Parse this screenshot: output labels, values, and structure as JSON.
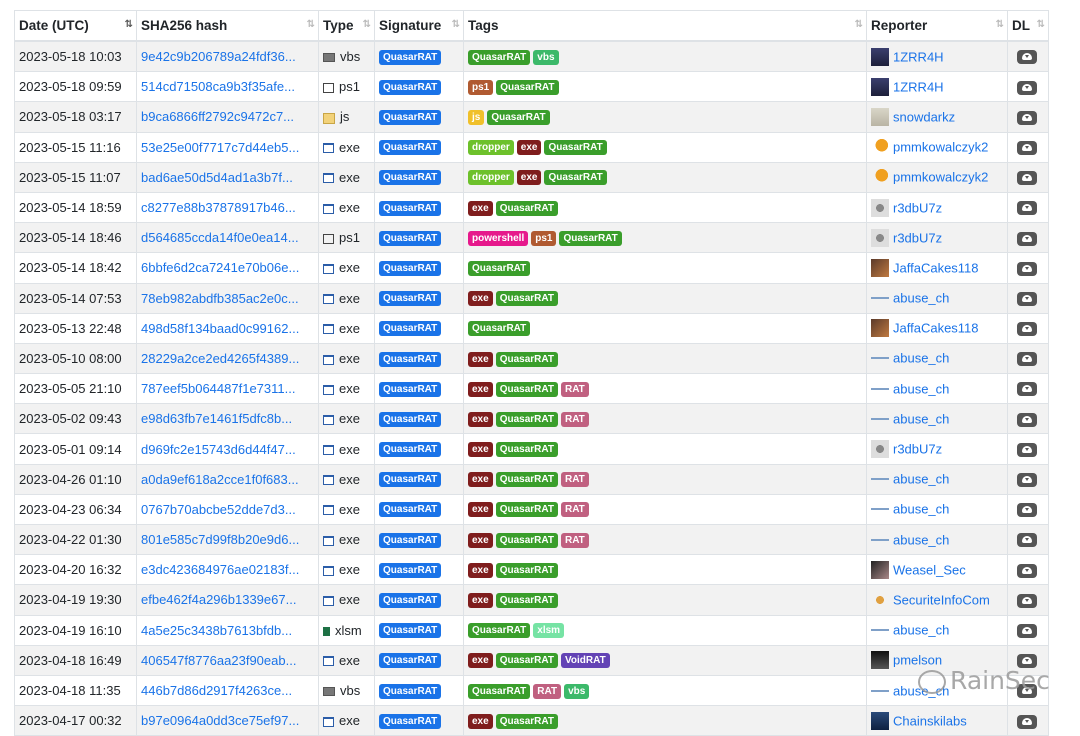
{
  "columns": {
    "date": "Date (UTC)",
    "hash": "SHA256 hash",
    "type": "Type",
    "signature": "Signature",
    "tags": "Tags",
    "reporter": "Reporter",
    "dl": "DL"
  },
  "sort_icon": "⇅",
  "colors": {
    "link": "#1a73e8",
    "signature": "#1a73e8",
    "tag_quasarrat": "#3a9e2b",
    "tag_vbs": "#3cb96a",
    "tag_ps1": "#b05a31",
    "tag_js": "#f0c02a",
    "tag_dropper": "#6dc12b",
    "tag_exe": "#7f1d1d",
    "tag_powershell": "#e6198c",
    "tag_rat": "#c06080",
    "tag_xlsm": "#76e3a4",
    "tag_voidrat": "#6343b5"
  },
  "rows": [
    {
      "date": "2023-05-18 10:03",
      "hash": "9e42c9b206789a24fdf36...",
      "type": "vbs",
      "type_icon": "vbs",
      "signature": "QuasarRAT",
      "tags": [
        "QuasarRAT",
        "vbs"
      ],
      "reporter": "1ZRR4H",
      "avatar": "av-1zrr4h"
    },
    {
      "date": "2023-05-18 09:59",
      "hash": "514cd71508ca9b3f35afe...",
      "type": "ps1",
      "type_icon": "ps1",
      "signature": "QuasarRAT",
      "tags": [
        "ps1",
        "QuasarRAT"
      ],
      "reporter": "1ZRR4H",
      "avatar": "av-1zrr4h"
    },
    {
      "date": "2023-05-18 03:17",
      "hash": "b9ca6866ff2792c9472c7...",
      "type": "js",
      "type_icon": "js",
      "signature": "QuasarRAT",
      "tags": [
        "js",
        "QuasarRAT"
      ],
      "reporter": "snowdarkz",
      "avatar": "av-snow"
    },
    {
      "date": "2023-05-15 11:16",
      "hash": "53e25e00f7717c7d44eb5...",
      "type": "exe",
      "type_icon": "exe",
      "signature": "QuasarRAT",
      "tags": [
        "dropper",
        "exe",
        "QuasarRAT"
      ],
      "reporter": "pmmkowalczyk2",
      "avatar": "av-pmm"
    },
    {
      "date": "2023-05-15 11:07",
      "hash": "bad6ae50d5d4ad1a3b7f...",
      "type": "exe",
      "type_icon": "exe",
      "signature": "QuasarRAT",
      "tags": [
        "dropper",
        "exe",
        "QuasarRAT"
      ],
      "reporter": "pmmkowalczyk2",
      "avatar": "av-pmm"
    },
    {
      "date": "2023-05-14 18:59",
      "hash": "c8277e88b37878917b46...",
      "type": "exe",
      "type_icon": "exe",
      "signature": "QuasarRAT",
      "tags": [
        "exe",
        "QuasarRAT"
      ],
      "reporter": "r3dbU7z",
      "avatar": "av-r3d"
    },
    {
      "date": "2023-05-14 18:46",
      "hash": "d564685ccda14f0e0ea14...",
      "type": "ps1",
      "type_icon": "ps1",
      "signature": "QuasarRAT",
      "tags": [
        "powershell",
        "ps1",
        "QuasarRAT"
      ],
      "reporter": "r3dbU7z",
      "avatar": "av-r3d"
    },
    {
      "date": "2023-05-14 18:42",
      "hash": "6bbfe6d2ca7241e70b06e...",
      "type": "exe",
      "type_icon": "exe",
      "signature": "QuasarRAT",
      "tags": [
        "QuasarRAT"
      ],
      "reporter": "JaffaCakes118",
      "avatar": "av-jaffa"
    },
    {
      "date": "2023-05-14 07:53",
      "hash": "78eb982abdfb385ac2e0c...",
      "type": "exe",
      "type_icon": "exe",
      "signature": "QuasarRAT",
      "tags": [
        "exe",
        "QuasarRAT"
      ],
      "reporter": "abuse_ch",
      "avatar": "av-abuse"
    },
    {
      "date": "2023-05-13 22:48",
      "hash": "498d58f134baad0c99162...",
      "type": "exe",
      "type_icon": "exe",
      "signature": "QuasarRAT",
      "tags": [
        "QuasarRAT"
      ],
      "reporter": "JaffaCakes118",
      "avatar": "av-jaffa"
    },
    {
      "date": "2023-05-10 08:00",
      "hash": "28229a2ce2ed4265f4389...",
      "type": "exe",
      "type_icon": "exe",
      "signature": "QuasarRAT",
      "tags": [
        "exe",
        "QuasarRAT"
      ],
      "reporter": "abuse_ch",
      "avatar": "av-abuse"
    },
    {
      "date": "2023-05-05 21:10",
      "hash": "787eef5b064487f1e7311...",
      "type": "exe",
      "type_icon": "exe",
      "signature": "QuasarRAT",
      "tags": [
        "exe",
        "QuasarRAT",
        "RAT"
      ],
      "reporter": "abuse_ch",
      "avatar": "av-abuse"
    },
    {
      "date": "2023-05-02 09:43",
      "hash": "e98d63fb7e1461f5dfc8b...",
      "type": "exe",
      "type_icon": "exe",
      "signature": "QuasarRAT",
      "tags": [
        "exe",
        "QuasarRAT",
        "RAT"
      ],
      "reporter": "abuse_ch",
      "avatar": "av-abuse"
    },
    {
      "date": "2023-05-01 09:14",
      "hash": "d969fc2e15743d6d44f47...",
      "type": "exe",
      "type_icon": "exe",
      "signature": "QuasarRAT",
      "tags": [
        "exe",
        "QuasarRAT"
      ],
      "reporter": "r3dbU7z",
      "avatar": "av-r3d"
    },
    {
      "date": "2023-04-26 01:10",
      "hash": "a0da9ef618a2cce1f0f683...",
      "type": "exe",
      "type_icon": "exe",
      "signature": "QuasarRAT",
      "tags": [
        "exe",
        "QuasarRAT",
        "RAT"
      ],
      "reporter": "abuse_ch",
      "avatar": "av-abuse"
    },
    {
      "date": "2023-04-23 06:34",
      "hash": "0767b70abcbe52dde7d3...",
      "type": "exe",
      "type_icon": "exe",
      "signature": "QuasarRAT",
      "tags": [
        "exe",
        "QuasarRAT",
        "RAT"
      ],
      "reporter": "abuse_ch",
      "avatar": "av-abuse"
    },
    {
      "date": "2023-04-22 01:30",
      "hash": "801e585c7d99f8b20e9d6...",
      "type": "exe",
      "type_icon": "exe",
      "signature": "QuasarRAT",
      "tags": [
        "exe",
        "QuasarRAT",
        "RAT"
      ],
      "reporter": "abuse_ch",
      "avatar": "av-abuse"
    },
    {
      "date": "2023-04-20 16:32",
      "hash": "e3dc423684976ae02183f...",
      "type": "exe",
      "type_icon": "exe",
      "signature": "QuasarRAT",
      "tags": [
        "exe",
        "QuasarRAT"
      ],
      "reporter": "Weasel_Sec",
      "avatar": "av-weasel"
    },
    {
      "date": "2023-04-19 19:30",
      "hash": "efbe462f4a296b1339e67...",
      "type": "exe",
      "type_icon": "exe",
      "signature": "QuasarRAT",
      "tags": [
        "exe",
        "QuasarRAT"
      ],
      "reporter": "SecuriteInfoCom",
      "avatar": "av-sic"
    },
    {
      "date": "2023-04-19 16:10",
      "hash": "4a5e25c3438b7613bfdb...",
      "type": "xlsm",
      "type_icon": "xlsm",
      "signature": "QuasarRAT",
      "tags": [
        "QuasarRAT",
        "xlsm"
      ],
      "reporter": "abuse_ch",
      "avatar": "av-abuse"
    },
    {
      "date": "2023-04-18 16:49",
      "hash": "406547f8776aa23f90eab...",
      "type": "exe",
      "type_icon": "exe",
      "signature": "QuasarRAT",
      "tags": [
        "exe",
        "QuasarRAT",
        "VoidRAT"
      ],
      "reporter": "pmelson",
      "avatar": "av-pmelson"
    },
    {
      "date": "2023-04-18 11:35",
      "hash": "446b7d86d2917f4263ce...",
      "type": "vbs",
      "type_icon": "vbs",
      "signature": "QuasarRAT",
      "tags": [
        "QuasarRAT",
        "RAT",
        "vbs"
      ],
      "reporter": "abuse_ch",
      "avatar": "av-abuse"
    },
    {
      "date": "2023-04-17 00:32",
      "hash": "b97e0964a0dd3ce75ef97...",
      "type": "exe",
      "type_icon": "exe",
      "signature": "QuasarRAT",
      "tags": [
        "exe",
        "QuasarRAT"
      ],
      "reporter": "Chainskilabs",
      "avatar": "av-chain"
    }
  ],
  "watermark": "RainSec"
}
